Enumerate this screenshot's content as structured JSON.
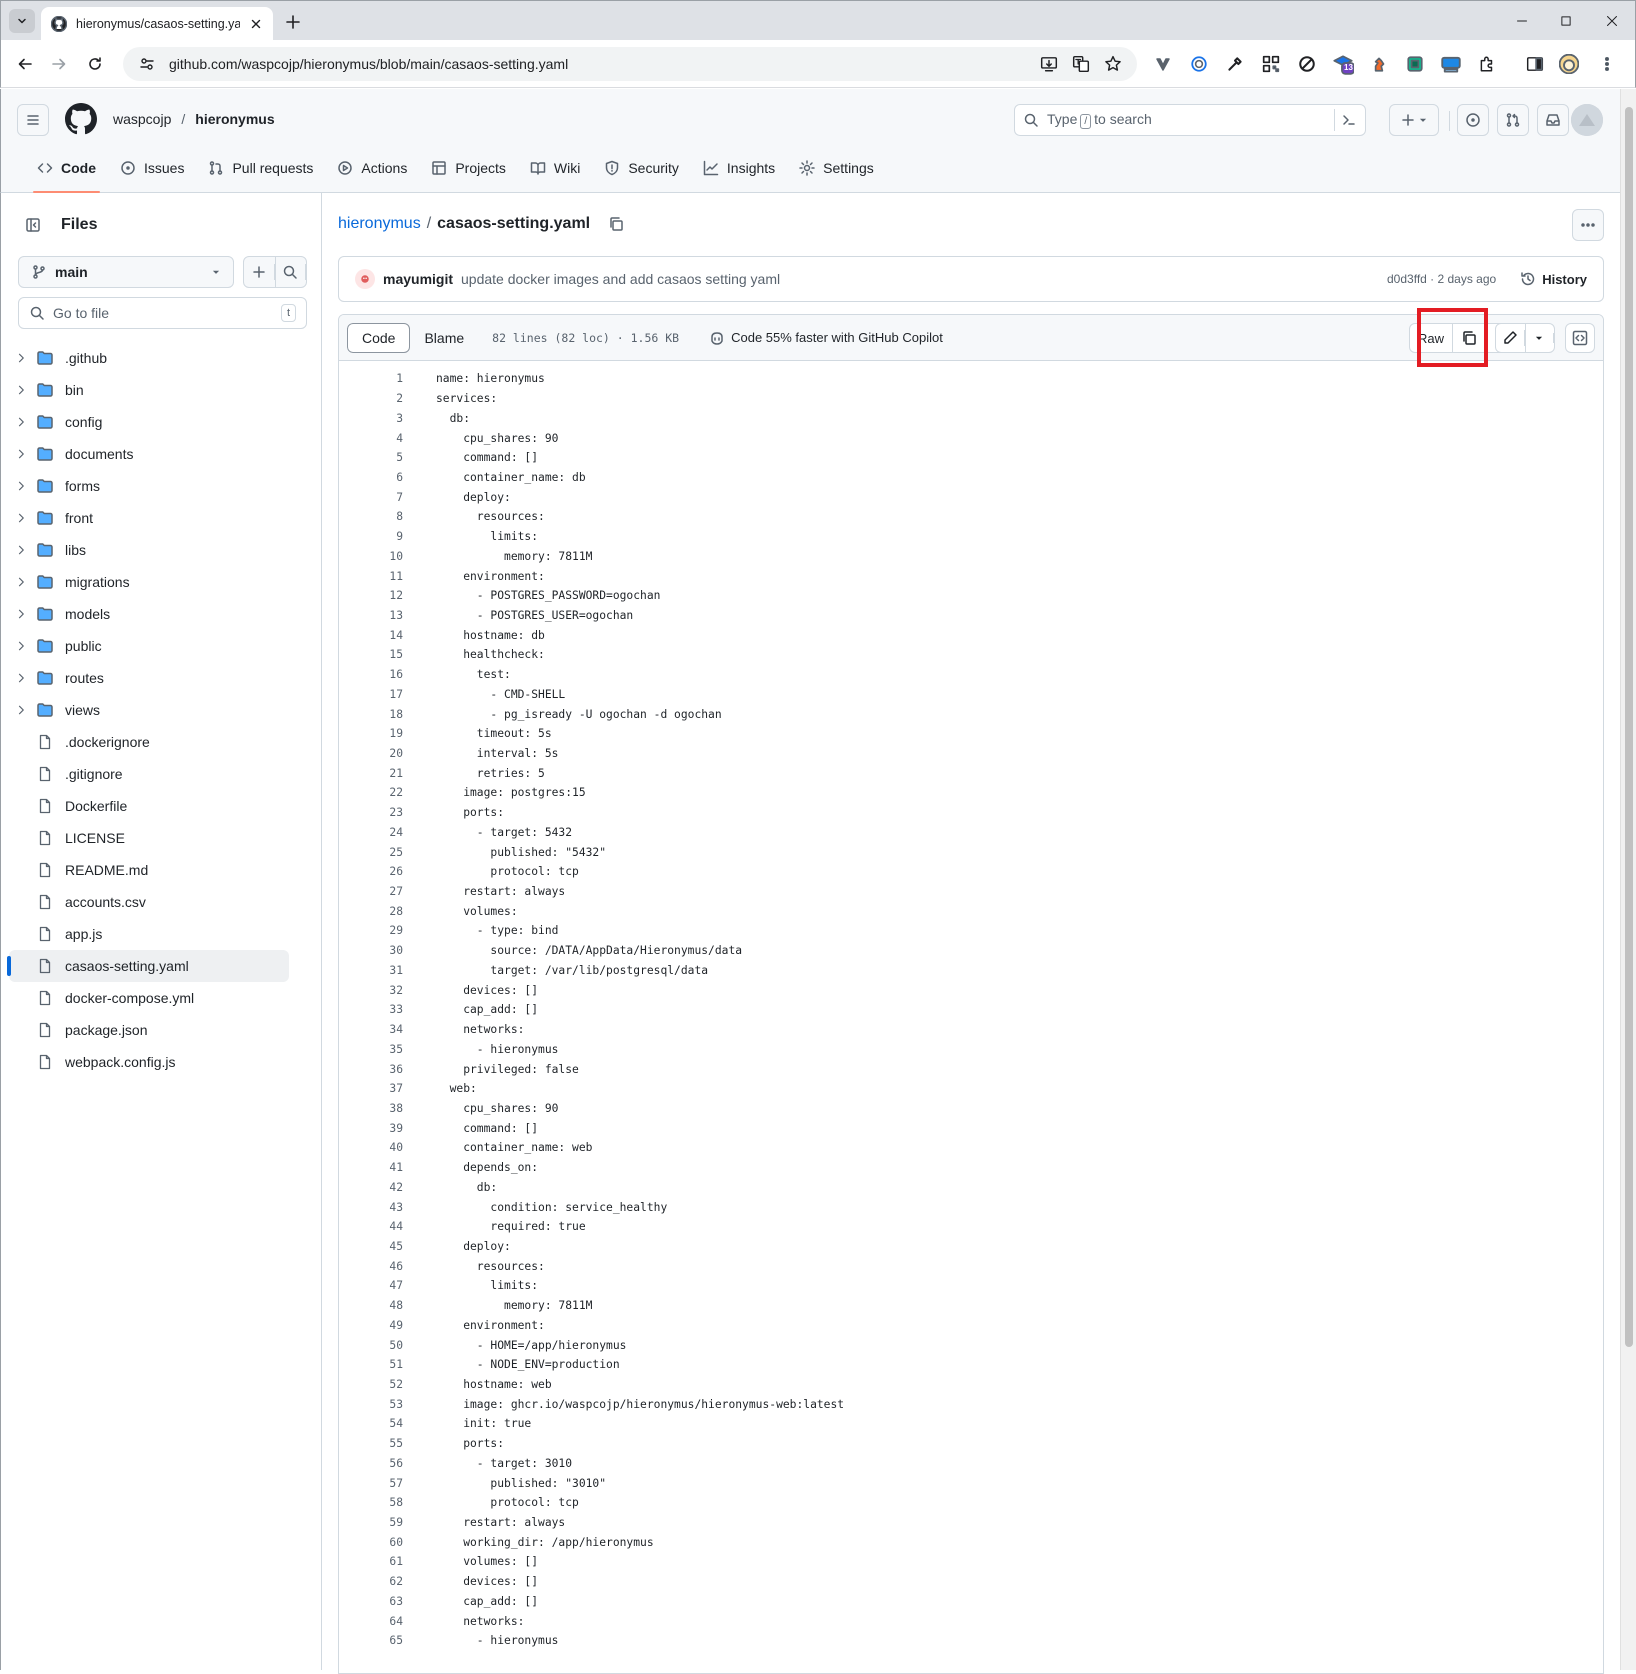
{
  "browser": {
    "tab_title": "hieronymus/casaos-setting.yam",
    "url": "github.com/waspcojp/hieronymus/blob/main/casaos-setting.yaml",
    "extension_badge": "13"
  },
  "header": {
    "owner": "waspcojp",
    "separator": "/",
    "repo": "hieronymus",
    "search_placeholder_pre": "Type",
    "search_key": "/",
    "search_placeholder_post": "to search"
  },
  "repo_nav": [
    {
      "label": "Code",
      "icon": "code-icon"
    },
    {
      "label": "Issues",
      "icon": "issue-icon"
    },
    {
      "label": "Pull requests",
      "icon": "pull-request-icon"
    },
    {
      "label": "Actions",
      "icon": "play-icon"
    },
    {
      "label": "Projects",
      "icon": "table-icon"
    },
    {
      "label": "Wiki",
      "icon": "book-icon"
    },
    {
      "label": "Security",
      "icon": "shield-icon"
    },
    {
      "label": "Insights",
      "icon": "graph-icon"
    },
    {
      "label": "Settings",
      "icon": "gear-icon"
    }
  ],
  "sidebar": {
    "title": "Files",
    "branch": "main",
    "goto_placeholder": "Go to file",
    "goto_key": "t",
    "tree": [
      {
        "name": ".github",
        "type": "dir"
      },
      {
        "name": "bin",
        "type": "dir"
      },
      {
        "name": "config",
        "type": "dir"
      },
      {
        "name": "documents",
        "type": "dir"
      },
      {
        "name": "forms",
        "type": "dir"
      },
      {
        "name": "front",
        "type": "dir"
      },
      {
        "name": "libs",
        "type": "dir"
      },
      {
        "name": "migrations",
        "type": "dir"
      },
      {
        "name": "models",
        "type": "dir"
      },
      {
        "name": "public",
        "type": "dir"
      },
      {
        "name": "routes",
        "type": "dir"
      },
      {
        "name": "views",
        "type": "dir"
      },
      {
        "name": ".dockerignore",
        "type": "file"
      },
      {
        "name": ".gitignore",
        "type": "file"
      },
      {
        "name": "Dockerfile",
        "type": "file"
      },
      {
        "name": "LICENSE",
        "type": "file"
      },
      {
        "name": "README.md",
        "type": "file"
      },
      {
        "name": "accounts.csv",
        "type": "file"
      },
      {
        "name": "app.js",
        "type": "file"
      },
      {
        "name": "casaos-setting.yaml",
        "type": "file",
        "selected": true
      },
      {
        "name": "docker-compose.yml",
        "type": "file"
      },
      {
        "name": "package.json",
        "type": "file"
      },
      {
        "name": "webpack.config.js",
        "type": "file"
      }
    ]
  },
  "file": {
    "repo_link": "hieronymus",
    "separator": "/",
    "name": "casaos-setting.yaml",
    "commit": {
      "author": "mayumigit",
      "message": "update docker images and add casaos setting yaml",
      "meta": "d0d3ffd · 2 days ago",
      "history_label": "History"
    },
    "toolbar": {
      "code_tab": "Code",
      "blame_tab": "Blame",
      "info": "82 lines (82 loc) · 1.56 KB",
      "copilot": "Code 55% faster with GitHub Copilot",
      "raw_label": "Raw"
    },
    "lines": [
      "name: hieronymus",
      "services:",
      "  db:",
      "    cpu_shares: 90",
      "    command: []",
      "    container_name: db",
      "    deploy:",
      "      resources:",
      "        limits:",
      "          memory: 7811M",
      "    environment:",
      "      - POSTGRES_PASSWORD=ogochan",
      "      - POSTGRES_USER=ogochan",
      "    hostname: db",
      "    healthcheck:",
      "      test:",
      "        - CMD-SHELL",
      "        - pg_isready -U ogochan -d ogochan",
      "      timeout: 5s",
      "      interval: 5s",
      "      retries: 5",
      "    image: postgres:15",
      "    ports:",
      "      - target: 5432",
      "        published: \"5432\"",
      "        protocol: tcp",
      "    restart: always",
      "    volumes:",
      "      - type: bind",
      "        source: /DATA/AppData/Hieronymus/data",
      "        target: /var/lib/postgresql/data",
      "    devices: []",
      "    cap_add: []",
      "    networks:",
      "      - hieronymus",
      "    privileged: false",
      "  web:",
      "    cpu_shares: 90",
      "    command: []",
      "    container_name: web",
      "    depends_on:",
      "      db:",
      "        condition: service_healthy",
      "        required: true",
      "    deploy:",
      "      resources:",
      "        limits:",
      "          memory: 7811M",
      "    environment:",
      "      - HOME=/app/hieronymus",
      "      - NODE_ENV=production",
      "    hostname: web",
      "    image: ghcr.io/waspcojp/hieronymus/hieronymus-web:latest",
      "    init: true",
      "    ports:",
      "      - target: 3010",
      "        published: \"3010\"",
      "        protocol: tcp",
      "    restart: always",
      "    working_dir: /app/hieronymus",
      "    volumes: []",
      "    devices: []",
      "    cap_add: []",
      "    networks:",
      "      - hieronymus"
    ]
  },
  "colors": {
    "link": "#0969da",
    "folder": "#54aeff",
    "highlight_box": "#e31c23",
    "active_tab_underline": "#fd8c73"
  }
}
